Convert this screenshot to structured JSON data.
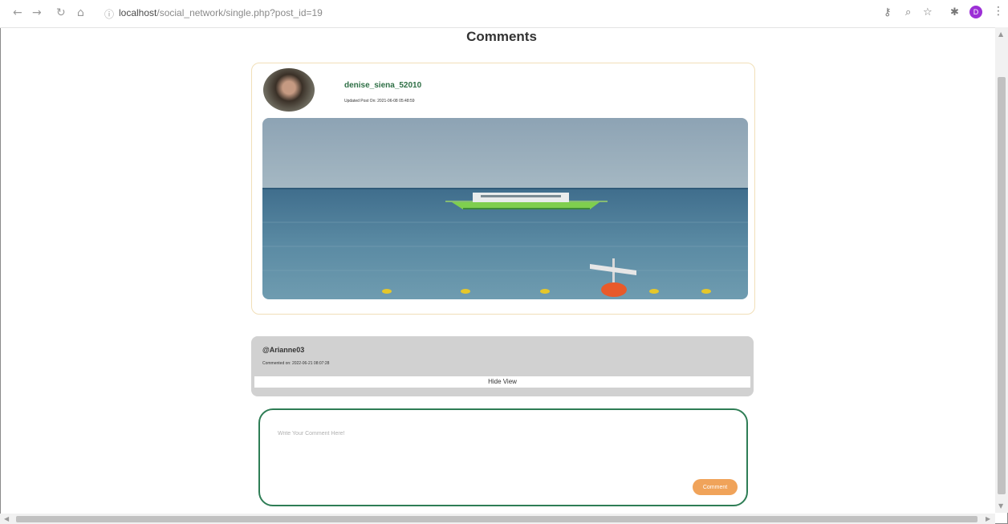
{
  "browser": {
    "url_host": "localhost",
    "url_path": "/social_network/single.php?post_id=19",
    "avatar_initial": "D"
  },
  "page": {
    "title": "Comments"
  },
  "post": {
    "username": "denise_siena_52010",
    "meta": "Updated Post On: 2021-06-08 05:48:59"
  },
  "comment": {
    "username": "@Arianne03",
    "meta": "Commented on: 2022-06-21 08:07:28",
    "view_label": "Hide View"
  },
  "comment_form": {
    "placeholder": "Write Your Comment Here!",
    "submit_label": "Comment"
  },
  "colors": {
    "accent_green": "#2e7d55",
    "accent_orange": "#f0a35a",
    "card_border": "#f1dfb8"
  }
}
